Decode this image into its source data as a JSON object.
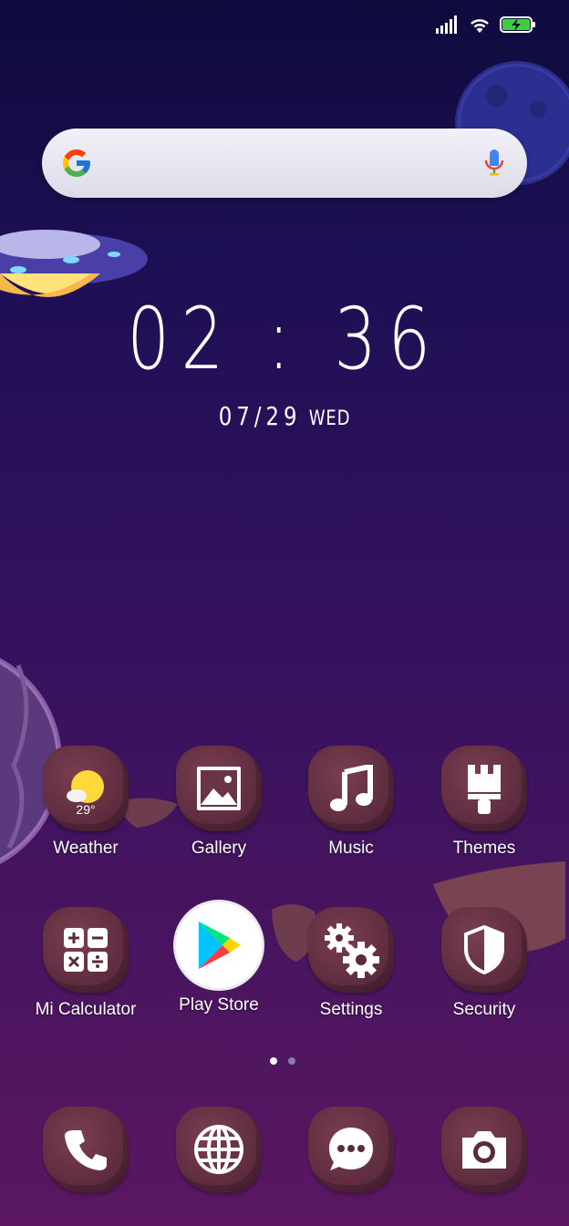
{
  "status_bar": {
    "signal_icon": "signal-icon",
    "wifi_icon": "wifi-icon",
    "battery_icon": "battery-charging-icon",
    "battery_color": "#3ecf3e"
  },
  "search": {
    "google_icon": "google-g-icon",
    "mic_icon": "mic-icon"
  },
  "clock": {
    "time": "02 : 36",
    "date": "07/29",
    "day": "WED"
  },
  "apps": [
    {
      "label": "Weather",
      "icon": "weather-sun-icon",
      "temp": "29°"
    },
    {
      "label": "Gallery",
      "icon": "image-icon"
    },
    {
      "label": "Music",
      "icon": "music-note-icon"
    },
    {
      "label": "Themes",
      "icon": "brush-icon"
    },
    {
      "label": "Mi Calculator",
      "icon": "calculator-icon"
    },
    {
      "label": "Play Store",
      "icon": "play-store-icon"
    },
    {
      "label": "Settings",
      "icon": "gear-icon"
    },
    {
      "label": "Security",
      "icon": "shield-icon"
    }
  ],
  "page_indicator": {
    "pages": 2,
    "active": 1,
    "active_color": "#ffffff",
    "inactive_color": "#8a7aa8"
  },
  "dock": [
    {
      "name": "Phone",
      "icon": "phone-icon"
    },
    {
      "name": "Browser",
      "icon": "globe-icon"
    },
    {
      "name": "Messages",
      "icon": "chat-bubble-icon"
    },
    {
      "name": "Camera",
      "icon": "camera-icon"
    }
  ]
}
